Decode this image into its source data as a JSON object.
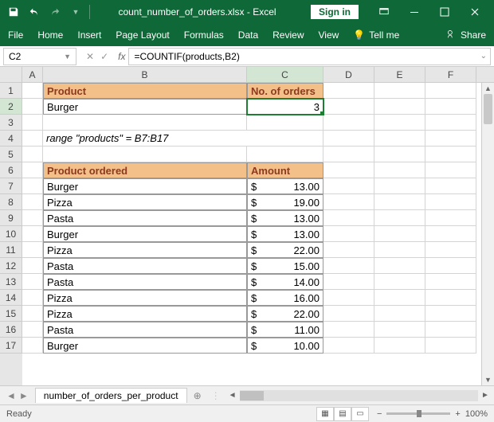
{
  "titlebar": {
    "filename": "count_number_of_orders.xlsx - Excel",
    "signin": "Sign in"
  },
  "ribbon": {
    "tabs": [
      "File",
      "Home",
      "Insert",
      "Page Layout",
      "Formulas",
      "Data",
      "Review",
      "View"
    ],
    "tellme": "Tell me",
    "share": "Share"
  },
  "formulabar": {
    "namebox": "C2",
    "formula": "=COUNTIF(products,B2)"
  },
  "columns": [
    "A",
    "B",
    "C",
    "D",
    "E",
    "F"
  ],
  "rows": [
    "1",
    "2",
    "3",
    "4",
    "5",
    "6",
    "7",
    "8",
    "9",
    "10",
    "11",
    "12",
    "13",
    "14",
    "15",
    "16",
    "17"
  ],
  "headers": {
    "product": "Product",
    "no_orders": "No. of orders",
    "product_ordered": "Product ordered",
    "amount": "Amount"
  },
  "summary": {
    "product": "Burger",
    "count": "3"
  },
  "note": "range \"products\" = B7:B17",
  "table": [
    {
      "product": "Burger",
      "cur": "$",
      "amount": "13.00"
    },
    {
      "product": "Pizza",
      "cur": "$",
      "amount": "19.00"
    },
    {
      "product": "Pasta",
      "cur": "$",
      "amount": "13.00"
    },
    {
      "product": "Burger",
      "cur": "$",
      "amount": "13.00"
    },
    {
      "product": "Pizza",
      "cur": "$",
      "amount": "22.00"
    },
    {
      "product": "Pasta",
      "cur": "$",
      "amount": "15.00"
    },
    {
      "product": "Pasta",
      "cur": "$",
      "amount": "14.00"
    },
    {
      "product": "Pizza",
      "cur": "$",
      "amount": "16.00"
    },
    {
      "product": "Pizza",
      "cur": "$",
      "amount": "22.00"
    },
    {
      "product": "Pasta",
      "cur": "$",
      "amount": "11.00"
    },
    {
      "product": "Burger",
      "cur": "$",
      "amount": "10.00"
    }
  ],
  "sheet": {
    "name": "number_of_orders_per_product"
  },
  "statusbar": {
    "ready": "Ready",
    "zoom": "100%"
  },
  "chart_data": {
    "type": "table",
    "title": "Count number of orders",
    "summary": {
      "product": "Burger",
      "no_of_orders": 3
    },
    "series": [
      {
        "product": "Burger",
        "amount": 13.0
      },
      {
        "product": "Pizza",
        "amount": 19.0
      },
      {
        "product": "Pasta",
        "amount": 13.0
      },
      {
        "product": "Burger",
        "amount": 13.0
      },
      {
        "product": "Pizza",
        "amount": 22.0
      },
      {
        "product": "Pasta",
        "amount": 15.0
      },
      {
        "product": "Pasta",
        "amount": 14.0
      },
      {
        "product": "Pizza",
        "amount": 16.0
      },
      {
        "product": "Pizza",
        "amount": 22.0
      },
      {
        "product": "Pasta",
        "amount": 11.0
      },
      {
        "product": "Burger",
        "amount": 10.0
      }
    ]
  }
}
